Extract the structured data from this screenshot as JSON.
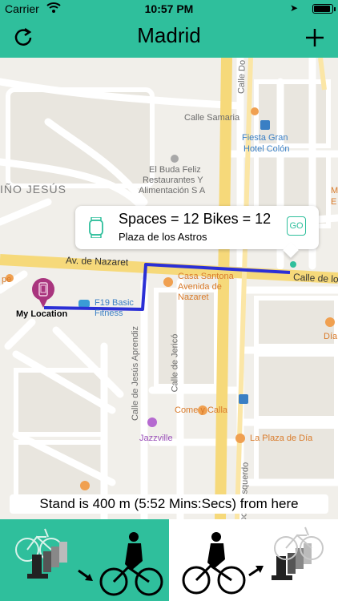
{
  "status_bar": {
    "carrier": "Carrier",
    "time": "10:57 PM",
    "battery_level": 0.9
  },
  "nav": {
    "title": "Madrid"
  },
  "map": {
    "labels": {
      "nino_jesus": "IÑO JESÚS",
      "calle_samaria": "Calle Samaria",
      "fiesta_gran": "Fiesta Gran",
      "hotel_colon": "Hotel Colón",
      "buda_1": "El Buda Feliz",
      "buda_2": "Restaurantes Y",
      "buda_3": "Alimentación S A",
      "av_nazaret": "Av. de Nazaret",
      "calle_de_lo": "Calle de lo",
      "casa_1": "Casa Santona",
      "casa_2": "Avenida de",
      "casa_3": "Nazaret",
      "pe": "pe",
      "f19_1": "F19 Basic",
      "f19_2": "Fitness",
      "dia_right": "Día",
      "jesus_aprendiz": "Calle de Jesús Aprendiz",
      "jerico": "Calle de Jericó",
      "come_calla": "Come y Calla",
      "jazzville": "Jazzville",
      "la_plaza": "La Plaza de Día",
      "doctor_esquerdo": "Doctor Esquerdo",
      "calle_do": "Calle Do",
      "m_right": "M",
      "e_right": "E"
    },
    "user_location_label": "My Location",
    "callout": {
      "title": "Spaces = 12 Bikes = 12",
      "subtitle": "Plaza de los Astros",
      "go_label": "GO"
    },
    "distance_text": "Stand is 400 m (5:52 Mins:Secs) from here"
  },
  "colors": {
    "accent": "#2fbf9c",
    "route": "#2b2fd6",
    "pin": "#a9357e"
  }
}
